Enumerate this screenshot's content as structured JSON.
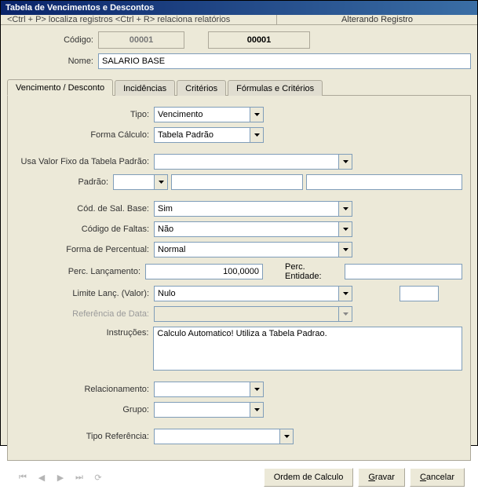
{
  "title": "Tabela de Vencimentos e Descontos",
  "hints": {
    "left": "<Ctrl + P> localiza registros  <Ctrl + R> relaciona relatórios",
    "right": "Alterando Registro"
  },
  "header": {
    "codigo_label": "Código:",
    "codigo_readonly": "00001",
    "codigo_bold": "00001",
    "nome_label": "Nome:",
    "nome_value": "SALARIO BASE"
  },
  "tabs": {
    "vencimento": "Vencimento / Desconto",
    "incidencias": "Incidências",
    "criterios": "Critérios",
    "formulas": "Fórmulas e Critérios"
  },
  "form": {
    "tipo_label": "Tipo:",
    "tipo_value": "Vencimento",
    "forma_calculo_label": "Forma Cálculo:",
    "forma_calculo_value": "Tabela Padrão",
    "usa_valor_fixo_label": "Usa Valor Fixo da Tabela Padrão:",
    "usa_valor_fixo_value": "",
    "padrao_label": "Padrão:",
    "padrao_value": "",
    "padrao_desc1": "",
    "padrao_desc2": "",
    "cod_sal_base_label": "Cód. de Sal. Base:",
    "cod_sal_base_value": "Sim",
    "codigo_faltas_label": "Código de Faltas:",
    "codigo_faltas_value": "Não",
    "forma_percentual_label": "Forma de Percentual:",
    "forma_percentual_value": "Normal",
    "perc_lancamento_label": "Perc. Lançamento:",
    "perc_lancamento_value": "100,0000",
    "perc_entidade_label": "Perc. Entidade:",
    "perc_entidade_value": "",
    "limite_lanc_label": "Limite Lanç. (Valor):",
    "limite_lanc_value": "Nulo",
    "limite_extra_value": "",
    "ref_data_label": "Referência de Data:",
    "ref_data_value": "",
    "instrucoes_label": "Instruções:",
    "instrucoes_value": "Calculo Automatico! Utiliza a Tabela Padrao.",
    "relacionamento_label": "Relacionamento:",
    "relacionamento_value": "",
    "grupo_label": "Grupo:",
    "grupo_value": "",
    "tipo_ref_label": "Tipo Referência:",
    "tipo_ref_value": ""
  },
  "footer": {
    "ordem": "Ordem de Calculo",
    "gravar_pre": "",
    "gravar_u": "G",
    "gravar_post": "ravar",
    "cancelar_pre": "",
    "cancelar_u": "C",
    "cancelar_post": "ancelar"
  }
}
